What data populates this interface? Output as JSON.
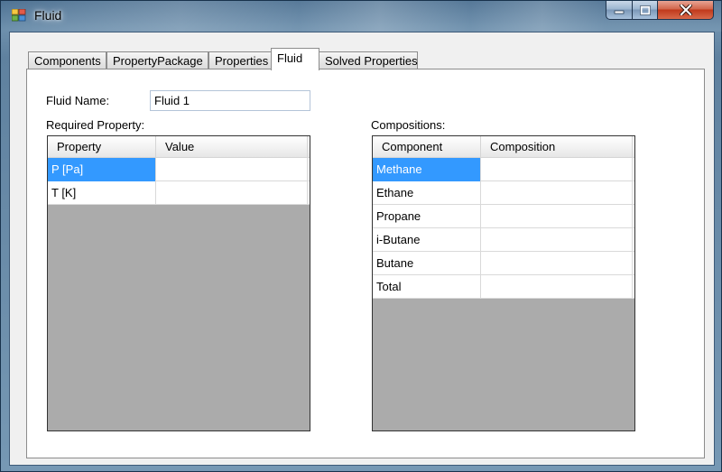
{
  "window": {
    "title": "Fluid",
    "controls": {
      "minimize_icon": "minimize-icon",
      "maximize_icon": "maximize-icon",
      "close_icon": "close-icon"
    }
  },
  "tabs": [
    {
      "label": "Components",
      "active": false
    },
    {
      "label": "PropertyPackage",
      "active": false
    },
    {
      "label": "Properties",
      "active": false
    },
    {
      "label": "Fluid",
      "active": true
    },
    {
      "label": "Solved Properties",
      "active": false
    }
  ],
  "fluid_name": {
    "label": "Fluid Name:",
    "value": "Fluid 1"
  },
  "required_property": {
    "label": "Required Property:",
    "columns": [
      "Property",
      "Value"
    ],
    "rows": [
      {
        "property": "P [Pa]",
        "value": "",
        "selected": true
      },
      {
        "property": "T [K]",
        "value": "",
        "selected": false
      }
    ]
  },
  "compositions": {
    "label": "Compositions:",
    "columns": [
      "Component",
      "Composition"
    ],
    "rows": [
      {
        "component": "Methane",
        "composition": "",
        "selected": true
      },
      {
        "component": "Ethane",
        "composition": ""
      },
      {
        "component": "Propane",
        "composition": ""
      },
      {
        "component": "i-Butane",
        "composition": ""
      },
      {
        "component": "Butane",
        "composition": ""
      },
      {
        "component": "Total",
        "composition": ""
      }
    ]
  },
  "colors": {
    "selection": "#3399ff",
    "grid_background": "#ababab"
  }
}
